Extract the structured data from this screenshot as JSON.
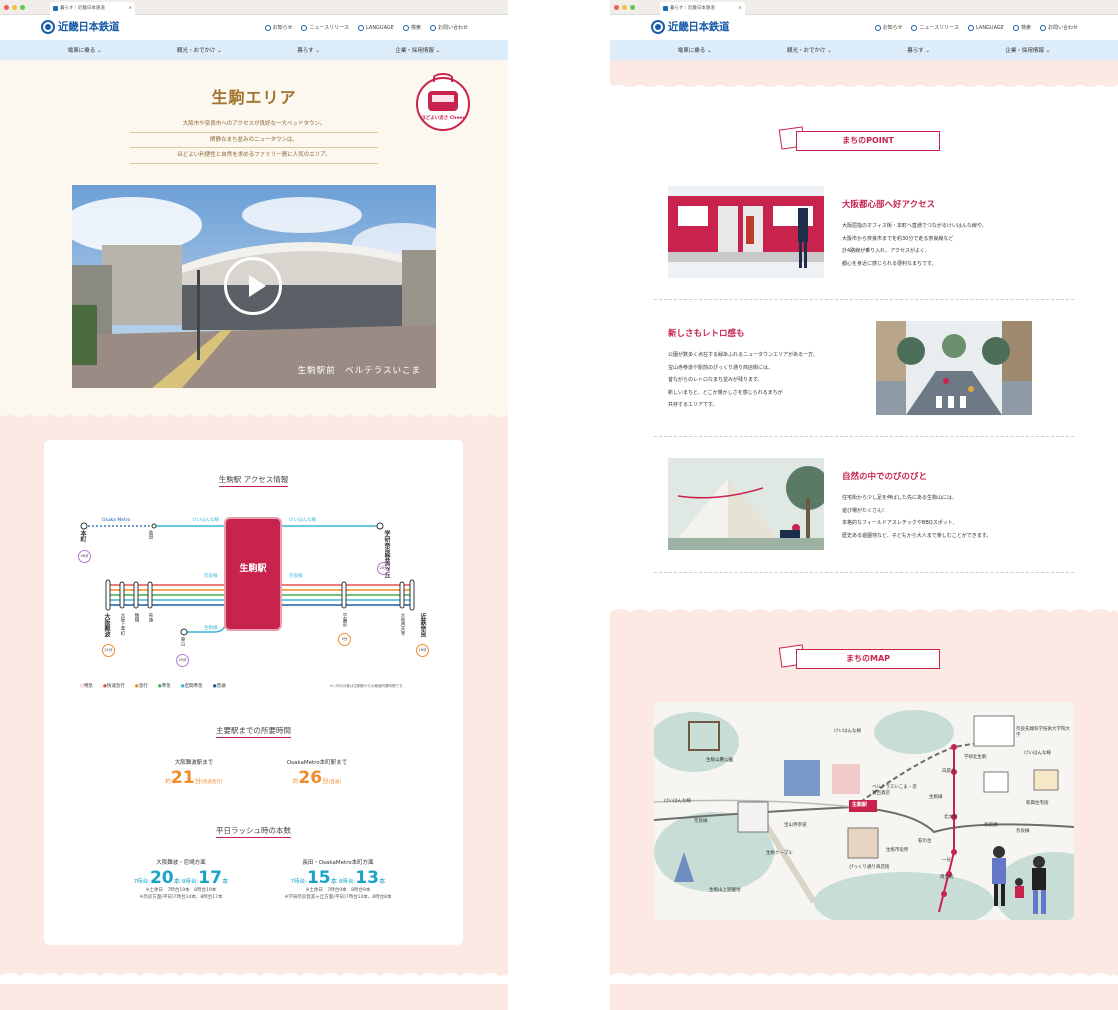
{
  "browser": {
    "tab_title": "暮らす｜近畿日本鉄道"
  },
  "header": {
    "logo": "近畿日本鉄道",
    "util": [
      "お知らせ",
      "ニュースリリース",
      "LANGUAGE",
      "検索",
      "お問い合わせ"
    ]
  },
  "gnav": [
    "電車に乗る",
    "観光・おでかけ",
    "暮らす",
    "企業・採用情報"
  ],
  "hero": {
    "title": "生駒エリア",
    "lead": [
      "大阪市や奈良市へのアクセスが良好な一大ベッドタウン。",
      "閑静なまち並みのニュータウンは、",
      "ほどよい利便性と自然を求めるファミリー層に人気のエリア。"
    ],
    "badge": "ほどよい近さ Cheer",
    "video_caption": "生駒駅前　ベルテラスいこま"
  },
  "access": {
    "title": "生駒駅 アクセス情報",
    "station": "生駒駅",
    "lines": {
      "osaka_metro": "Osaka Metro",
      "keihanna_l": "けいはんな線",
      "keihanna_r": "けいはんな線",
      "nara_l": "奈良線",
      "nara_r": "奈良線",
      "ikoma": "生駒線"
    },
    "stations": {
      "honmachi": "本町",
      "nagata": "長田",
      "gakken": "学研奈良登美ヶ丘",
      "namba": "大阪難波",
      "uehonmachi": "大阪上本町",
      "tsuruhashi": "鶴橋",
      "fuse": "布施",
      "higashiyama": "東山",
      "gakuenmae": "学園前",
      "yamato": "大和西大寺",
      "kintetsunara": "近鉄奈良"
    },
    "times": {
      "honmachi": "26分",
      "gakken": "20分",
      "namba": "21分",
      "higashiyama": "20分",
      "gakuenmae": "5分",
      "kintetsunara": "16分"
    },
    "legend": [
      "特急",
      "快速急行",
      "急行",
      "準急",
      "区間準急",
      "普通"
    ],
    "legend_note": "※○内の分数は生駒駅からの最速所要時間です。",
    "travel_title": "主要駅までの所要時間",
    "travel": [
      {
        "label": "大阪難波駅まで",
        "prefix": "約",
        "num": "21",
        "unit": "分",
        "note": "(快速急行)"
      },
      {
        "label": "OsakaMetro本町駅まで",
        "prefix": "約",
        "num": "26",
        "unit": "分",
        "note": "(直通)"
      }
    ],
    "rush_title": "平日ラッシュ時の本数",
    "rush": [
      {
        "label": "大阪難波・尼崎方面",
        "a_pre": "7時台:",
        "a": "20",
        "a_u": "本",
        "b_pre": "8時台:",
        "b": "17",
        "b_u": "本",
        "notes": [
          "※土休日　7時台19本　8時台19本",
          "※奈良方面(平日)7時台14本、8時台17本"
        ]
      },
      {
        "label": "長田・OsakaMetro本町方面",
        "a_pre": "7時台:",
        "a": "15",
        "a_u": "本",
        "b_pre": "8時台:",
        "b": "13",
        "b_u": "本",
        "notes": [
          "※土休日　7時台9本　8時台9本",
          "※学研奈良登美ヶ丘方面(平日)7時台14本、8時台8本"
        ]
      }
    ]
  },
  "point": {
    "heading": "まちのPOINT",
    "items": [
      {
        "title": "大阪都心部へ好アクセス",
        "text": [
          "大阪屈指のオフィス街・本町へ直通でつながるけいはんな線や、",
          "大阪市から奈良市までを約30分で走る奈良線など",
          "計4路線が乗り入れ、アクセスがよく、",
          "都心を身近に感じられる便利なまちです。"
        ]
      },
      {
        "title": "新しさもレトロ感も",
        "text": [
          "公園が数多く点在する緑あふれるニュータウンエリアがある一方、",
          "宝山寺参道や駅前のぴっくり通り商店街には、",
          "昔ながらのレトロなまち並みが残ります。",
          "新しいまちと、どこか懐かしさを感じられるまちが",
          "共存するエリアです。"
        ]
      },
      {
        "title": "自然の中でのびのびと",
        "text": [
          "住宅街から少し足を伸ばした先にある生駒山には、",
          "遊び場がたくさん!",
          "本格的なフィールドアスレチックやBBQスポット、",
          "歴史ある遊園地など、子どもから大人まで楽しむことができます。"
        ]
      }
    ]
  },
  "map": {
    "heading": "まちのMAP",
    "labels": {
      "station": "生駒駅",
      "park": "生駒山麓公園",
      "keihanna1": "けいはんな線",
      "keihanna2": "けいはんな線",
      "keihanna3": "けいはんな線",
      "naist": "奈良先端科学技術大学院大学",
      "gakken": "学研北生駒",
      "shiraniwa": "白庭台",
      "ikomaline": "生駒線",
      "hokuto": "北大和",
      "housing": "新興住宅街",
      "belterrace": "ベルテラスいこま・近鉄百貨店",
      "hozanji": "宝山寺参道",
      "bikkuri": "ぴっくり通り商店街",
      "cable": "生駒ケーブル",
      "hagiwara": "萩の台",
      "ichibu": "一分",
      "minamiikoma": "南生駒",
      "ikomayama": "生駒山上遊園地",
      "ikomashi": "生駒市役所",
      "nara1": "奈良線",
      "nara2": "奈良線",
      "nara3": "奈良線"
    }
  }
}
